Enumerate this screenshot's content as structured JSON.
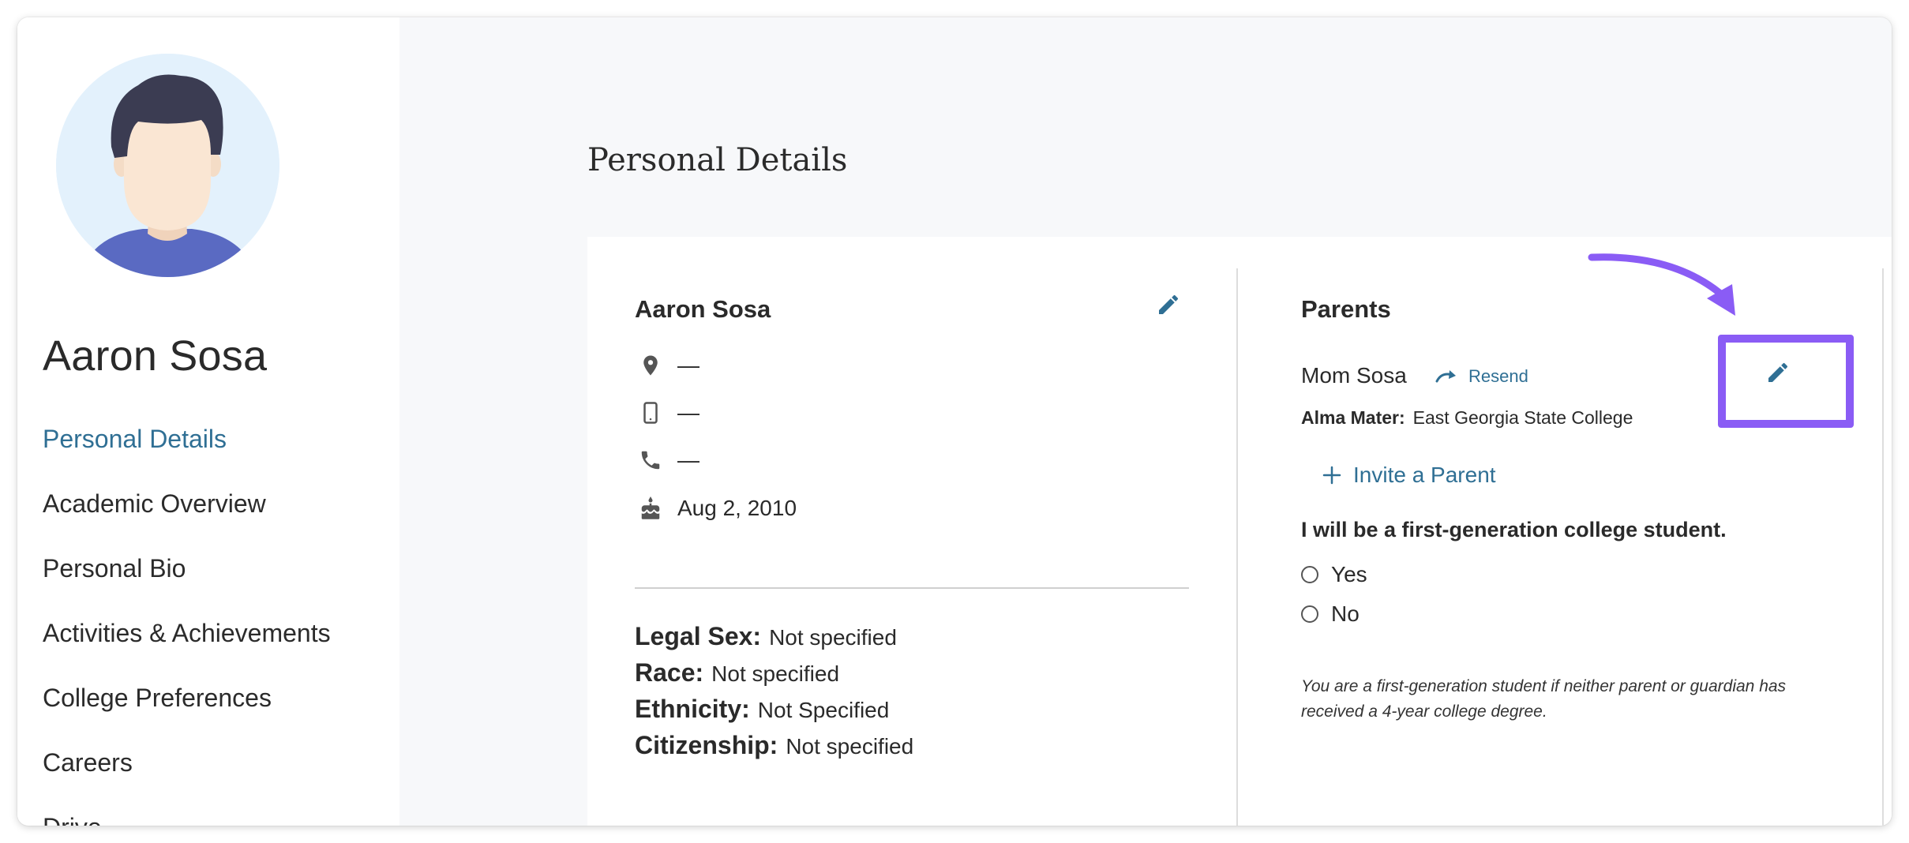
{
  "sidebar": {
    "profile_name": "Aaron Sosa",
    "items": [
      {
        "label": "Personal Details",
        "active": true
      },
      {
        "label": "Academic Overview"
      },
      {
        "label": "Personal Bio"
      },
      {
        "label": "Activities & Achievements"
      },
      {
        "label": "College Preferences"
      },
      {
        "label": "Careers"
      },
      {
        "label": "Drive"
      }
    ]
  },
  "main": {
    "title": "Personal Details",
    "student": {
      "name": "Aaron Sosa",
      "location": "—",
      "mobile": "—",
      "phone": "—",
      "birthday": "Aug 2, 2010",
      "icons": [
        "location-pin-icon",
        "mobile-phone-icon",
        "phone-icon",
        "birthday-cake-icon",
        "pencil-edit-icon"
      ]
    },
    "attributes": [
      {
        "label": "Legal Sex:",
        "value": "Not specified"
      },
      {
        "label": "Race:",
        "value": "Not specified"
      },
      {
        "label": "Ethnicity:",
        "value": "Not Specified"
      },
      {
        "label": "Citizenship:",
        "value": "Not specified"
      }
    ],
    "parents": {
      "title": "Parents",
      "parent_name": "Mom Sosa",
      "resend_label": "Resend",
      "alma_label": "Alma Mater:",
      "alma_value": "East Georgia State College",
      "invite_label": "Invite a Parent",
      "question": "I will be a first-generation college student.",
      "options": [
        "Yes",
        "No"
      ],
      "note": "You are a first-generation student if neither parent or guardian has received a 4-year college degree."
    }
  },
  "colors": {
    "accent": "#2f6f94",
    "highlight": "#8a5cf5",
    "background": "#f7f8fa"
  }
}
